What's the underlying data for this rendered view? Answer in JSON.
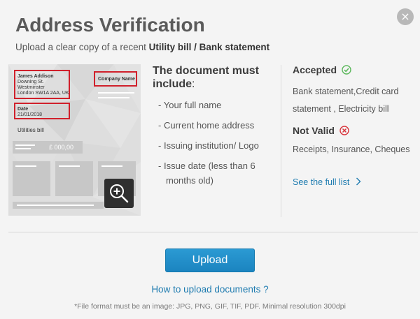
{
  "header": {
    "title": "Address Verification",
    "subtitle_prefix": "Upload a clear copy of a recent ",
    "subtitle_bold": "Utility bill / Bank statement",
    "close_label": "×"
  },
  "document_preview": {
    "name": "James Addison",
    "address_line1": "Downing St.",
    "address_line2": "Westminster",
    "address_line3": "London SW1A 2AA, UK",
    "company_label": "Company Name",
    "date_label": "Date",
    "date_value": "21/01/2018",
    "bill_type": "Utilities bill",
    "amount": "£ 000,00"
  },
  "requirements": {
    "title_line1": "The document must",
    "title_line2": "include",
    "title_colon": ":",
    "items": [
      "Your full name",
      "Current home address",
      "Issuing institution/ Logo",
      "Issue date (less than 6",
      "months old)"
    ],
    "bullet": "-"
  },
  "accepted": {
    "title": "Accepted",
    "text": "Bank statement,Credit card statement , Electricity bill",
    "icon_color": "#5cb85c"
  },
  "not_valid": {
    "title": "Not Valid",
    "text": "Receipts, Insurance, Cheques",
    "icon_color": "#d9363e"
  },
  "full_list_link": "See the full list",
  "upload_button": "Upload",
  "howto_link": "How to upload documents ?",
  "footnote": "*File format must be an image: JPG, PNG, GIF, TIF, PDF. Minimal resolution 300dpi",
  "colors": {
    "accent": "#1f7cb0",
    "button": "#2290cb",
    "highlight_box": "#d0202b"
  }
}
